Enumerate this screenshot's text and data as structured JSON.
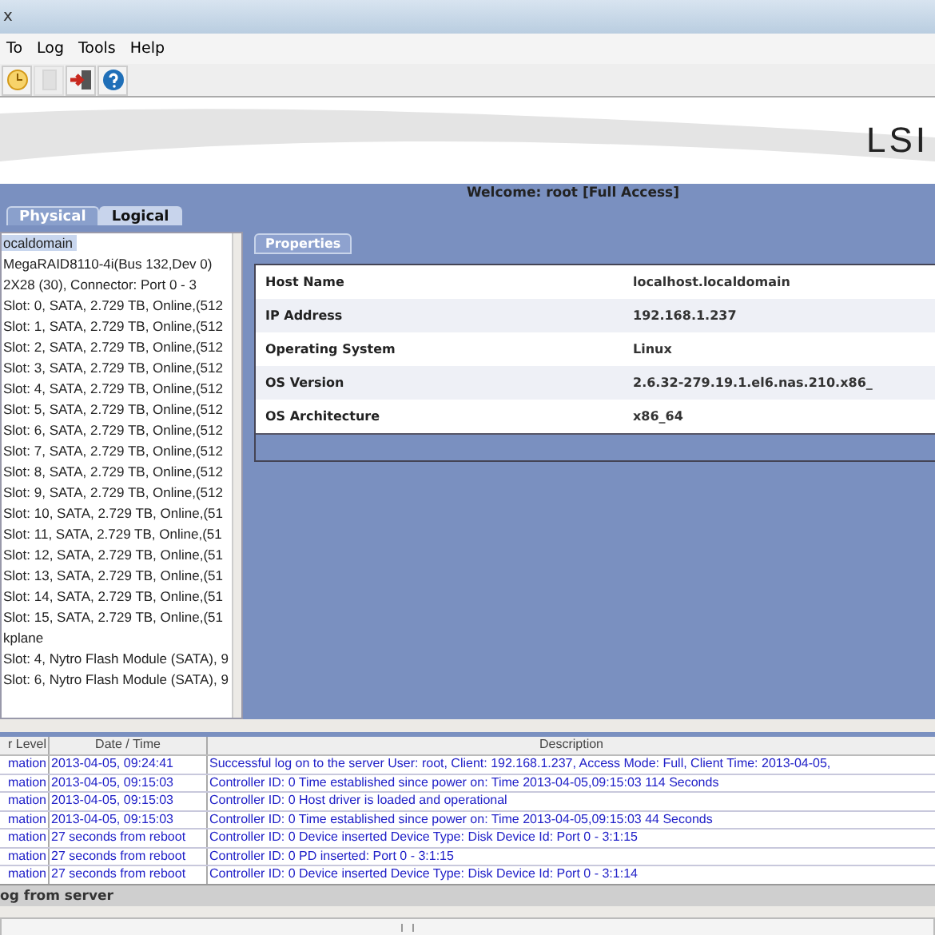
{
  "window": {
    "title": "x"
  },
  "menu": [
    "To",
    "Log",
    "Tools",
    "Help"
  ],
  "toolbar": [
    {
      "kind": "clock",
      "disabled": false
    },
    {
      "kind": "document",
      "disabled": true
    },
    {
      "kind": "exit",
      "disabled": false
    },
    {
      "kind": "help",
      "disabled": false
    }
  ],
  "banner": {
    "logo": "LSI"
  },
  "welcome": "Welcome: root [Full Access]",
  "view_tabs": [
    {
      "label": "Physical",
      "selected": false
    },
    {
      "label": "Logical",
      "selected": true
    }
  ],
  "tree": [
    {
      "label": "ocaldomain",
      "selected": true
    },
    {
      "label": "MegaRAID8110-4i(Bus 132,Dev 0)",
      "selected": false
    },
    {
      "label": "2X28 (30), Connector: Port 0 - 3",
      "selected": false
    },
    {
      "label": "Slot: 0, SATA, 2.729 TB, Online,(512",
      "selected": false
    },
    {
      "label": "Slot: 1, SATA, 2.729 TB, Online,(512",
      "selected": false
    },
    {
      "label": "Slot: 2, SATA, 2.729 TB, Online,(512",
      "selected": false
    },
    {
      "label": "Slot: 3, SATA, 2.729 TB, Online,(512",
      "selected": false
    },
    {
      "label": "Slot: 4, SATA, 2.729 TB, Online,(512",
      "selected": false
    },
    {
      "label": "Slot: 5, SATA, 2.729 TB, Online,(512",
      "selected": false
    },
    {
      "label": "Slot: 6, SATA, 2.729 TB, Online,(512",
      "selected": false
    },
    {
      "label": "Slot: 7, SATA, 2.729 TB, Online,(512",
      "selected": false
    },
    {
      "label": "Slot: 8, SATA, 2.729 TB, Online,(512",
      "selected": false
    },
    {
      "label": "Slot: 9, SATA, 2.729 TB, Online,(512",
      "selected": false
    },
    {
      "label": "Slot: 10, SATA, 2.729 TB, Online,(51",
      "selected": false
    },
    {
      "label": "Slot: 11, SATA, 2.729 TB, Online,(51",
      "selected": false
    },
    {
      "label": "Slot: 12, SATA, 2.729 TB, Online,(51",
      "selected": false
    },
    {
      "label": "Slot: 13, SATA, 2.729 TB, Online,(51",
      "selected": false
    },
    {
      "label": "Slot: 14, SATA, 2.729 TB, Online,(51",
      "selected": false
    },
    {
      "label": "Slot: 15, SATA, 2.729 TB, Online,(51",
      "selected": false
    },
    {
      "label": "kplane",
      "selected": false
    },
    {
      "label": "Slot: 4, Nytro Flash Module (SATA), 9",
      "selected": false
    },
    {
      "label": "Slot: 6, Nytro Flash Module (SATA), 9",
      "selected": false
    }
  ],
  "properties": {
    "tab": "Properties",
    "rows": [
      {
        "label": "Host Name",
        "value": "localhost.localdomain"
      },
      {
        "label": "IP Address",
        "value": "192.168.1.237"
      },
      {
        "label": "Operating System",
        "value": "Linux"
      },
      {
        "label": "OS Version",
        "value": "2.6.32-279.19.1.el6.nas.210.x86_"
      },
      {
        "label": "OS Architecture",
        "value": "x86_64"
      }
    ]
  },
  "log": {
    "columns": [
      "r Level",
      "Date / Time",
      "Description"
    ],
    "rows": [
      {
        "level": "mation",
        "time": "2013-04-05, 09:24:41",
        "description": "Successful log on to the server User:  root, Client:  192.168.1.237,   Access Mode:  Full, Client Time:  2013-04-05,"
      },
      {
        "level": "mation",
        "time": "2013-04-05, 09:15:03",
        "description": "Controller ID:  0   Time established since power on:  Time   2013-04-05,09:15:03     114  Seconds"
      },
      {
        "level": "mation",
        "time": "2013-04-05, 09:15:03",
        "description": "Controller ID:  0  Host driver is loaded and operational"
      },
      {
        "level": "mation",
        "time": "2013-04-05, 09:15:03",
        "description": "Controller ID:  0   Time established since power on:  Time   2013-04-05,09:15:03     44  Seconds"
      },
      {
        "level": "mation",
        "time": "27  seconds from reboot",
        "description": "Controller ID:  0  Device inserted   Device Type:    Disk  Device Id:  Port 0 - 3:1:15"
      },
      {
        "level": "mation",
        "time": "27  seconds from reboot",
        "description": "Controller ID:  0   PD inserted:     Port 0 - 3:1:15"
      },
      {
        "level": "mation",
        "time": "27  seconds from reboot",
        "description": "Controller ID:  0  Device inserted   Device Type:    Disk  Device Id:  Port 0 - 3:1:14"
      }
    ]
  },
  "status": "og from server"
}
